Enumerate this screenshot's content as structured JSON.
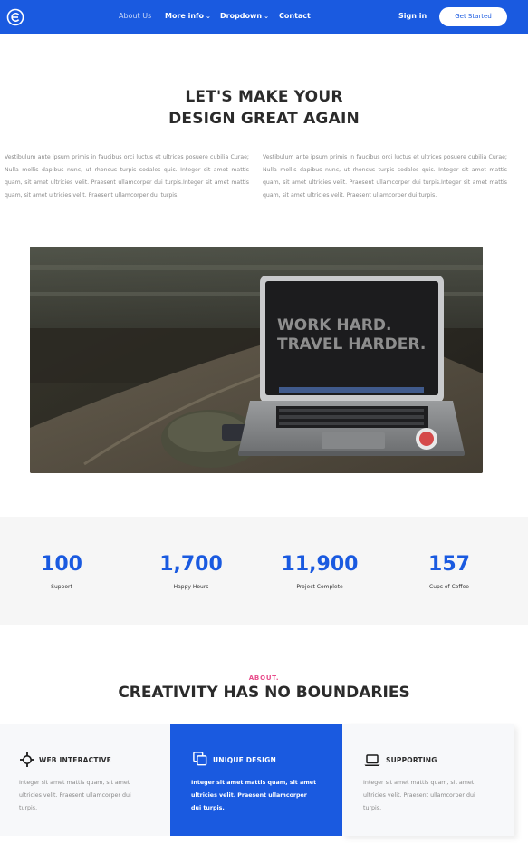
{
  "colors": {
    "brand": "#1a5ae0",
    "accent": "#e84c8b",
    "text": "#2b2b2b",
    "muted": "#8a8a8a"
  },
  "nav": {
    "logo_icon": "circle-e-logo",
    "links": [
      {
        "label": "About Us"
      },
      {
        "label": "More info"
      },
      {
        "label": "Dropdown"
      },
      {
        "label": "Contact"
      }
    ],
    "signin_label": "Sign in",
    "cta_label": "Get Started"
  },
  "hero": {
    "title_line1": "LET'S MAKE YOUR",
    "title_line2": "DESIGN GREAT AGAIN",
    "paragraphs": [
      "Vestibulum ante ipsum primis in faucibus orci luctus et ultrices posuere cubilia Curae; Nulla mollis dapibus nunc, ut rhoncus turpis sodales quis. Integer sit amet mattis quam, sit amet ultricies velit. Praesent ullamcorper dui turpis.Integer sit amet mattis quam, sit amet ultricies velit. Praesent ullamcorper dui turpis.",
      "Vestibulum ante ipsum primis in faucibus orci luctus et ultrices posuere cubilia Curae; Nulla mollis dapibus nunc, ut rhoncus turpis sodales quis. Integer sit amet mattis quam, sit amet ultricies velit. Praesent ullamcorper dui turpis.Integer sit amet mattis quam, sit amet ultricies velit. Praesent ullamcorper dui turpis."
    ],
    "image_text_line1": "WORK HARD.",
    "image_text_line2": "TRAVEL HARDER."
  },
  "stats": [
    {
      "value": "100",
      "label": "Support"
    },
    {
      "value": "1,700",
      "label": "Happy Hours"
    },
    {
      "value": "11,900",
      "label": "Project Complete"
    },
    {
      "value": "157",
      "label": "Cups of Coffee"
    }
  ],
  "about": {
    "kicker": "ABOUT.",
    "title": "CREATIVITY HAS NO BOUNDARIES",
    "features": [
      {
        "icon": "crosshair-icon",
        "title": "WEB INTERACTIVE",
        "text": "Integer sit amet mattis quam, sit amet ultricies velit. Praesent ullamcorper dui turpis."
      },
      {
        "icon": "copy-icon",
        "title": "UNIQUE DESIGN",
        "text": "Integer sit amet mattis quam, sit amet ultricies velit. Praesent ullamcorper dui turpis."
      },
      {
        "icon": "laptop-icon",
        "title": "SUPPORTING",
        "text": "Integer sit amet mattis quam, sit amet ultricies velit. Praesent ullamcorper dui turpis."
      }
    ]
  }
}
